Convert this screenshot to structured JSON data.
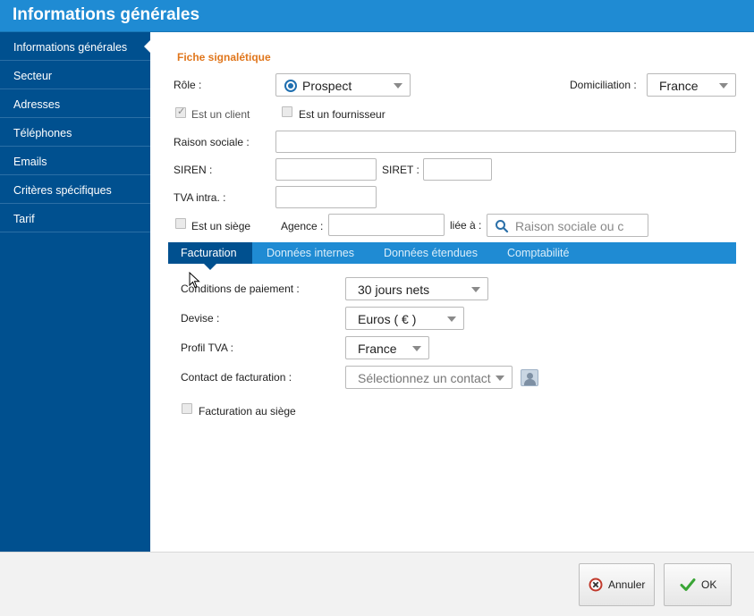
{
  "window": {
    "title": "Informations générales"
  },
  "sidebar": {
    "items": [
      {
        "label": "Informations générales",
        "active": true
      },
      {
        "label": "Secteur"
      },
      {
        "label": "Adresses"
      },
      {
        "label": "Téléphones"
      },
      {
        "label": "Emails"
      },
      {
        "label": "Critères spécifiques"
      },
      {
        "label": "Tarif"
      }
    ]
  },
  "fiche": {
    "section_title": "Fiche signalétique",
    "role_label": "Rôle :",
    "role_value": "Prospect",
    "domiciliation_label": "Domiciliation :",
    "domiciliation_value": "France",
    "client_label": "Est un client",
    "fournisseur_label": "Est un fournisseur",
    "raison_sociale_label": "Raison sociale :",
    "raison_sociale_value": "",
    "siren_label": "SIREN :",
    "siren_value": "",
    "siret_label": "SIRET :",
    "siret_value": "",
    "tva_label": "TVA intra. :",
    "tva_value": "",
    "siege_label": "Est un siège",
    "agence_label": "Agence :",
    "agence_value": "",
    "liee_label": "liée à :",
    "liee_placeholder": "Raison sociale ou c"
  },
  "tabs": [
    {
      "label": "Facturation",
      "active": true
    },
    {
      "label": "Données internes"
    },
    {
      "label": "Données étendues"
    },
    {
      "label": "Comptabilité"
    }
  ],
  "facturation": {
    "conditions_label": "Conditions de paiement :",
    "conditions_value": "30 jours nets",
    "devise_label": "Devise :",
    "devise_value": "Euros ( € )",
    "profil_label": "Profil TVA :",
    "profil_value": "France",
    "contact_label": "Contact de facturation :",
    "contact_placeholder": "Sélectionnez un contact",
    "siege_label": "Facturation au siège"
  },
  "footer": {
    "cancel_label": "Annuler",
    "ok_label": "OK"
  },
  "colors": {
    "header": "#1f8bd3",
    "sidebar": "#00508f",
    "accent_orange": "#e0761c"
  }
}
